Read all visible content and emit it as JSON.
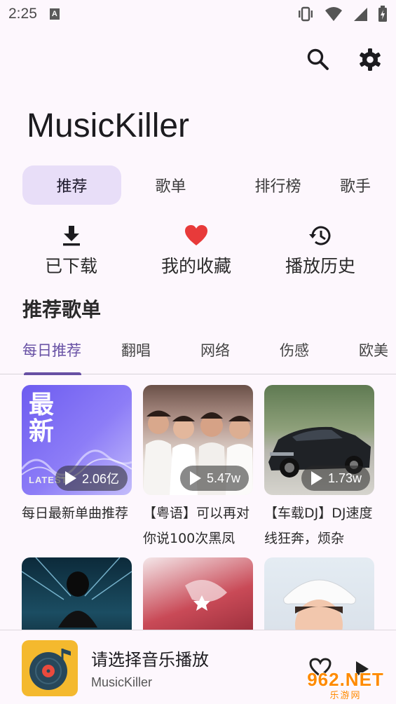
{
  "status": {
    "time": "2:25",
    "a_badge": "A"
  },
  "app": {
    "title": "MusicKiller"
  },
  "main_tabs": [
    "推荐",
    "歌单",
    "排行榜",
    "歌手"
  ],
  "quick_actions": [
    {
      "label": "已下载",
      "icon": "download-icon"
    },
    {
      "label": "我的收藏",
      "icon": "heart-icon"
    },
    {
      "label": "播放历史",
      "icon": "history-icon"
    }
  ],
  "section": {
    "title": "推荐歌单"
  },
  "category_tabs": [
    "每日推荐",
    "翻唱",
    "网络",
    "伤感",
    "欧美"
  ],
  "playlists": [
    {
      "title": "每日最新单曲推荐",
      "count": "2.06亿",
      "cover_text": "最新",
      "cover_sub": "LATEST"
    },
    {
      "title": "【粤语】可以再对你说100次黑凤",
      "count": "5.47w"
    },
    {
      "title": "【车载DJ】DJ速度线狂奔，烦杂",
      "count": "1.73w"
    },
    {
      "title": "",
      "count": ""
    },
    {
      "title": "",
      "count": ""
    },
    {
      "title": "",
      "count": ""
    }
  ],
  "player": {
    "title": "请选择音乐播放",
    "subtitle": "MusicKiller"
  },
  "watermark": {
    "line1": "962.NET",
    "line2": "乐游网"
  },
  "colors": {
    "accent": "#6750a4",
    "tab_active_bg": "#e8def8",
    "heart": "#e83a3a",
    "background": "#fdf7fd"
  }
}
